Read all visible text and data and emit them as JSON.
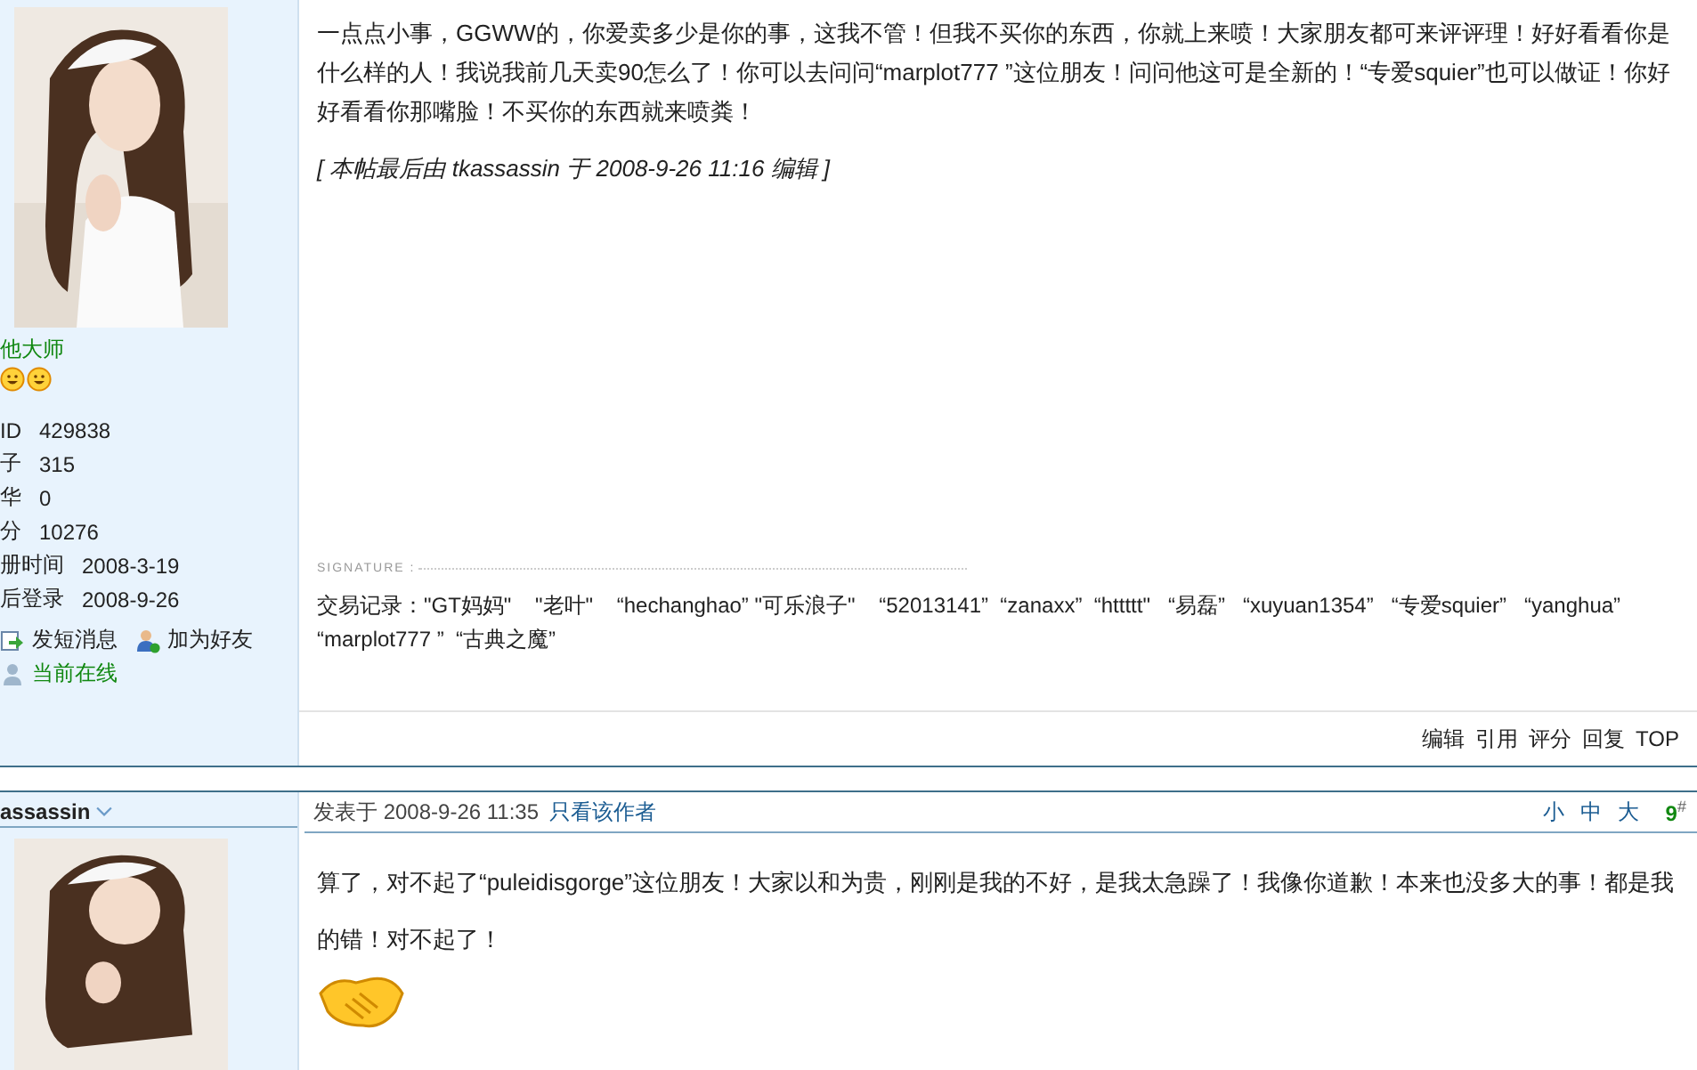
{
  "posts": [
    {
      "author": {
        "name": "他大师",
        "stats": [
          {
            "label": "ID",
            "value": "429838"
          },
          {
            "label": "子",
            "value": "315"
          },
          {
            "label": "华",
            "value": "0"
          },
          {
            "label": "分",
            "value": "10276"
          },
          {
            "label": "册时间",
            "value": "2008-3-19"
          },
          {
            "label": "后登录",
            "value": "2008-9-26"
          }
        ],
        "actions": [
          {
            "kind": "message",
            "label": "发短消息"
          },
          {
            "kind": "friend",
            "label": "加为好友"
          }
        ],
        "status": "当前在线"
      },
      "body": "一点点小事，GGWW的，你爱卖多少是你的事，这我不管！但我不买你的东西，你就上来喷！大家朋友都可来评评理！好好看看你是什么样的人！我说我前几天卖90怎么了！你可以去问问“marplot777 ”这位朋友！问问他这可是全新的！“专爱squier”也可以做证！你好好看看你那嘴脸！不买你的东西就来喷粪！",
      "edit_note": "[ 本帖最后由 tkassassin 于 2008-9-26 11:16 编辑 ]",
      "signature_label": "SIGNATURE :",
      "signature": "交易记录：\"GT妈妈\"    \"老叶\"    “hechanghao” \"可乐浪子\"    “52013141”  “zanaxx”  “httttt\"   “易磊”   “xuyuan1354”   “专爱squier”   “yanghua”      “marplot777 ”  “古典之魔”",
      "footer_actions": [
        "编辑",
        "引用",
        "评分",
        "回复",
        "TOP"
      ]
    },
    {
      "author": {
        "name": "assassin"
      },
      "posted": "发表于  2008-9-26 11:35",
      "author_only_link": "只看该作者",
      "font_sizes": [
        "小",
        "中",
        "大"
      ],
      "floor": "9",
      "floor_mark": "#",
      "body": "算了，对不起了“puleidisgorge”这位朋友！大家以和为贵，刚刚是我的不好，是我太急躁了！我像你道歉！本来也没多大的事！都是我的错！对不起了！"
    }
  ]
}
